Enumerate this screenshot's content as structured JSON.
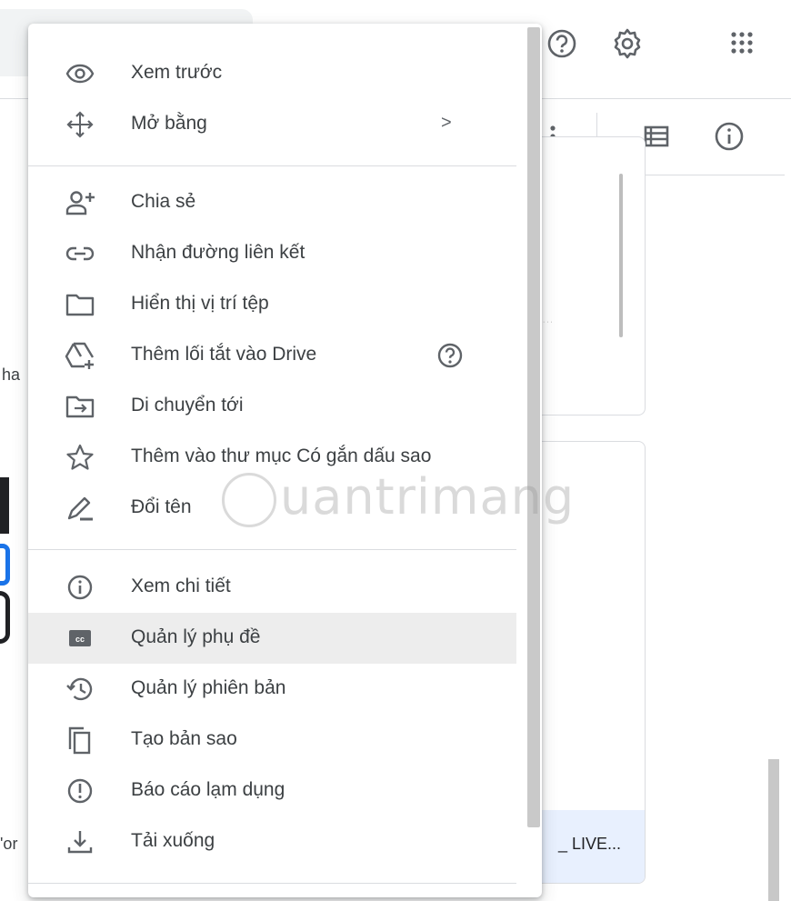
{
  "menu": {
    "sections": [
      {
        "items": [
          {
            "icon": "eye-icon",
            "label": "Xem trước"
          },
          {
            "icon": "move-arrows-icon",
            "label": "Mở bằng",
            "right": ">"
          }
        ]
      },
      {
        "items": [
          {
            "icon": "person-add-icon",
            "label": "Chia sẻ"
          },
          {
            "icon": "link-icon",
            "label": "Nhận đường liên kết"
          },
          {
            "icon": "folder-icon",
            "label": "Hiển thị vị trí tệp"
          },
          {
            "icon": "drive-shortcut-icon",
            "label": "Thêm lối tắt vào Drive",
            "right_icon": "help-icon"
          },
          {
            "icon": "move-folder-icon",
            "label": "Di chuyển tới"
          },
          {
            "icon": "star-icon",
            "label": "Thêm vào thư mục Có gắn dấu sao"
          },
          {
            "icon": "pencil-icon",
            "label": "Đổi tên"
          }
        ]
      },
      {
        "items": [
          {
            "icon": "info-icon",
            "label": "Xem chi tiết"
          },
          {
            "icon": "closed-caption-icon",
            "label": "Quản lý phụ đề",
            "active": true
          },
          {
            "icon": "history-icon",
            "label": "Quản lý phiên bản"
          },
          {
            "icon": "copy-icon",
            "label": "Tạo bản sao"
          },
          {
            "icon": "report-icon",
            "label": "Báo cáo lạm dụng"
          },
          {
            "icon": "download-icon",
            "label": "Tải xuống"
          }
        ]
      }
    ]
  },
  "header": {
    "icons": [
      "help-icon",
      "settings-icon",
      "apps-grid-icon"
    ]
  },
  "toolbar": {
    "icons": [
      "more-vert-icon",
      "list-view-icon",
      "info-icon"
    ]
  },
  "background": {
    "card_name": "_ LIVE...",
    "left_fragment_1": "ha",
    "left_fragment_2": "'or"
  },
  "watermark": {
    "text": "uantrimang"
  },
  "colors": {
    "active_item": "#ededed",
    "text": "#3c4043",
    "divider": "#dadce0"
  }
}
